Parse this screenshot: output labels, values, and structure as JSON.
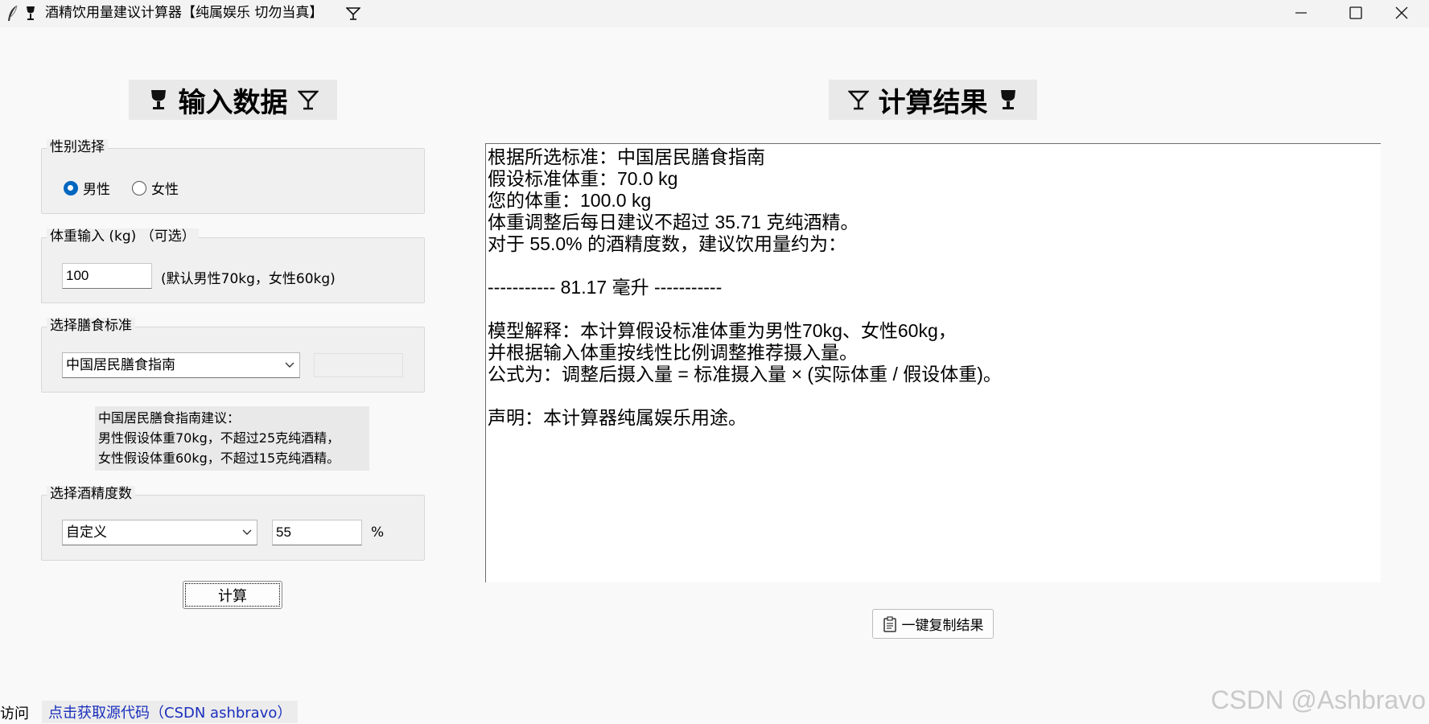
{
  "window": {
    "title": "酒精饮用量建议计算器【纯属娱乐 切勿当真】"
  },
  "left": {
    "heading": "输入数据",
    "gender": {
      "label": "性别选择",
      "male": "男性",
      "female": "女性",
      "selected": "男性"
    },
    "weight": {
      "label": "体重输入 (kg) （可选）",
      "value": "100",
      "hint": "(默认男性70kg，女性60kg)"
    },
    "standard": {
      "label": "选择膳食标准",
      "selected": "中国居民膳食指南"
    },
    "note": "中国居民膳食指南建议：\n男性假设体重70kg，不超过25克纯酒精，\n女性假设体重60kg，不超过15克纯酒精。",
    "abv": {
      "label": "选择酒精度数",
      "selected": "自定义",
      "value": "55",
      "unit": "%"
    },
    "calc_button": "计算"
  },
  "right": {
    "heading": "计算结果",
    "result_text": "根据所选标准：中国居民膳食指南\n假设标准体重：70.0 kg\n您的体重：100.0 kg\n体重调整后每日建议不超过 35.71 克纯酒精。\n对于 55.0% 的酒精度数，建议饮用量约为：\n\n----------- 81.17 毫升 -----------\n\n模型解释：本计算假设标准体重为男性70kg、女性60kg，\n并根据输入体重按线性比例调整推荐摄入量。\n公式为：调整后摄入量 = 标准摄入量 × (实际体重 / 假设体重)。\n\n声明：本计算器纯属娱乐用途。",
    "copy_button": "一键复制结果"
  },
  "footer": {
    "visit_label": "访问",
    "source_link": "点击获取源代码（CSDN ashbravo）"
  },
  "watermark": "CSDN @Ashbravo",
  "icons": {
    "title_left": [
      "feather-icon",
      "goblet-icon"
    ],
    "title_right": "cocktail-icon"
  }
}
